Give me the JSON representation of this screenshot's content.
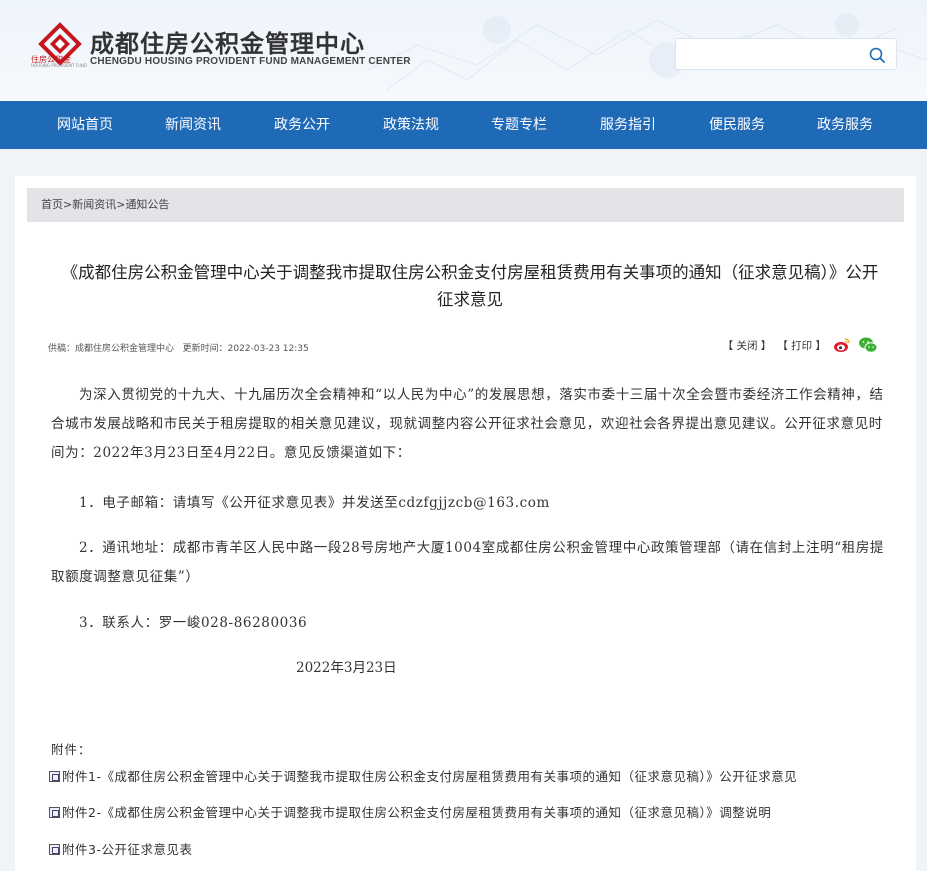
{
  "header": {
    "logo_text": "住房公积金",
    "logo_subtext": "HOUSING PROVIDENT FUND",
    "brand_cn": "成都住房公积金管理中心",
    "brand_en": "CHENGDU HOUSING PROVIDENT FUND MANAGEMENT CENTER",
    "search": {
      "value": "",
      "placeholder": ""
    }
  },
  "nav": {
    "items": [
      {
        "label": "网站首页"
      },
      {
        "label": "新闻资讯"
      },
      {
        "label": "政务公开"
      },
      {
        "label": "政策法规"
      },
      {
        "label": "专题专栏"
      },
      {
        "label": "服务指引"
      },
      {
        "label": "便民服务"
      },
      {
        "label": "政务服务"
      }
    ]
  },
  "breadcrumb": {
    "items": [
      "首页",
      "新闻资讯",
      "通知公告"
    ],
    "separator": ">"
  },
  "article": {
    "title": "《成都住房公积金管理中心关于调整我市提取住房公积金支付房屋租赁费用有关事项的通知（征求意见稿）》公开征求意见",
    "meta": {
      "source_label": "供稿：",
      "source": "成都住房公积金管理中心",
      "updated_label": "更新时间：",
      "updated": "2022-03-23 12:35"
    },
    "tools": {
      "close": "【 关闭 】",
      "print": "【 打印 】"
    },
    "paragraphs": [
      "为深入贯彻党的十九大、十九届历次全会精神和“以人民为中心”的发展思想，落实市委十三届十次全会暨市委经济工作会精神，结合城市发展战略和市民关于租房提取的相关意见建议，现就调整内容公开征求社会意见，欢迎社会各界提出意见建议。公开征求意见时间为：2022年3月23日至4月22日。意见反馈渠道如下：",
      "1．电子邮箱：请填写《公开征求意见表》并发送至cdzfgjjzcb@163.com",
      "2．通讯地址：成都市青羊区人民中路一段28号房地产大厦1004室成都住房公积金管理中心政策管理部（请在信封上注明“租房提取额度调整意见征集”）",
      "3．联系人：罗一峻028-86280036"
    ],
    "date": "2022年3月23日",
    "attachments_label": "附件：",
    "attachments": [
      "附件1-《成都住房公积金管理中心关于调整我市提取住房公积金支付房屋租赁费用有关事项的通知（征求意见稿）》公开征求意见",
      "附件2-《成都住房公积金管理中心关于调整我市提取住房公积金支付房屋租赁费用有关事项的通知（征求意见稿）》调整说明",
      "附件3-公开征求意见表"
    ]
  },
  "colors": {
    "nav_bg": "#1f6ab7",
    "logo_red": "#c4161c",
    "page_bg": "#f0f3f8",
    "breadcrumb_bg": "#e2e4e8"
  },
  "icons": {
    "logo": "housing-fund-logo-icon",
    "search": "search-icon",
    "weibo": "weibo-icon",
    "wechat": "wechat-icon",
    "attachment": "doc-icon"
  }
}
